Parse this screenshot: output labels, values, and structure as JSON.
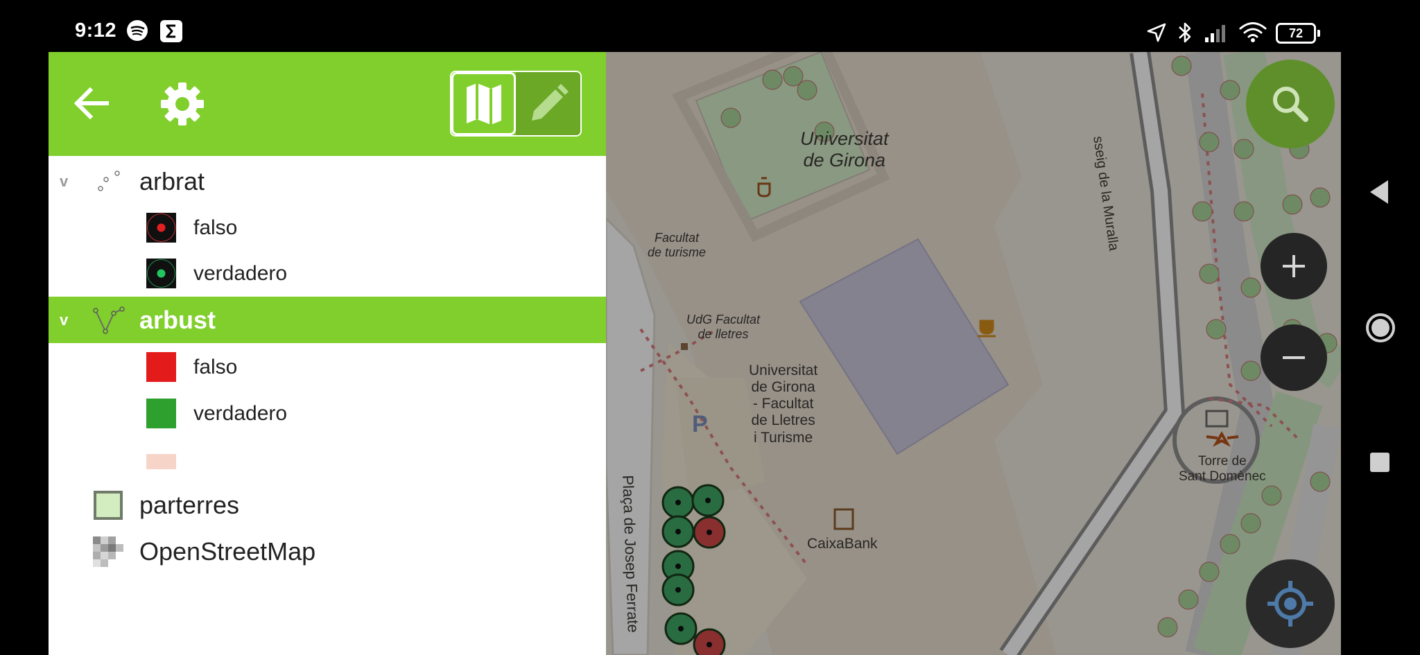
{
  "status_bar": {
    "time": "9:12",
    "battery": "72",
    "icons": [
      "spotify-icon",
      "sigma-icon",
      "location-icon",
      "bluetooth-icon",
      "signal-icon",
      "wifi-icon",
      "battery-icon"
    ]
  },
  "header": {
    "back_icon": "back-arrow-icon",
    "settings_icon": "gear-icon",
    "mode_map_icon": "map-icon",
    "mode_edit_icon": "pencil-icon",
    "accent_color": "#80cf2c"
  },
  "layers": [
    {
      "name": "arbrat",
      "expanded_marker": "v",
      "selected": false,
      "categories": [
        {
          "label": "falso",
          "color": "#e02020"
        },
        {
          "label": "verdadero",
          "color": "#22c55e"
        }
      ]
    },
    {
      "name": "arbust",
      "expanded_marker": "v",
      "selected": true,
      "categories": [
        {
          "label": "falso",
          "color": "#e31b1b"
        },
        {
          "label": "verdadero",
          "color": "#2ea02e"
        },
        {
          "label": "",
          "color": "#f6d5c8"
        }
      ]
    },
    {
      "name": "parterres",
      "selected": false
    },
    {
      "name": "OpenStreetMap",
      "selected": false
    }
  ],
  "map": {
    "labels": {
      "univ_girona": "Universitat\nde Girona",
      "fac_turisme": "Facultat\nde turisme",
      "udg_lletres": "UdG Facultat\nde lletres",
      "univ_lletres": "Universitat\nde Girona\n- Facultat\nde Lletres\ni Turisme",
      "street_muralla": "sseig de la Muralla",
      "street_ferrater": "Plaça de Josep Ferrate",
      "caixabank": "CaixaBank",
      "torre": "Torre de\nSant Domènec",
      "parking": "P"
    },
    "controls": [
      "search-icon",
      "zoom-in-icon",
      "zoom-out-icon",
      "locate-icon"
    ]
  },
  "nav": [
    "back-triangle-icon",
    "home-circle-icon",
    "recents-square-icon"
  ]
}
